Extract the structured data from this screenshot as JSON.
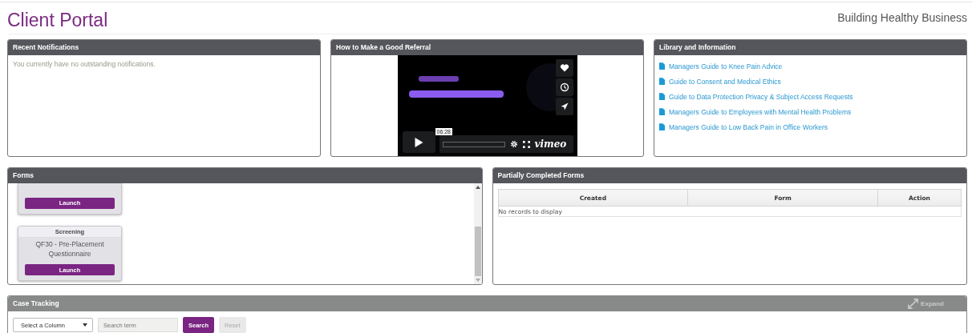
{
  "header": {
    "title": "Client Portal",
    "tagline": "Building Healthy Business"
  },
  "notifications": {
    "title": "Recent Notifications",
    "message": "You currently have no outstanding notifications."
  },
  "video": {
    "title": "How to Make a Good Referral",
    "player": {
      "time": "06:28",
      "brand": "vimeo"
    }
  },
  "library": {
    "title": "Library and Information",
    "links": [
      "Managers Guide to Knee Pain Advice",
      "Guide to Consent and Medical Ethics",
      "Guide to Data Protection Privacy & Subject Access Requests",
      "Managers Guide to Employees with Mental Health Problems",
      "Managers Guide to Low Back Pain in Office Workers"
    ]
  },
  "forms": {
    "title": "Forms",
    "cards": [
      {
        "launch": "Launch"
      },
      {
        "category": "Screening",
        "name": "QF30 - Pre-Placement Questionnaire",
        "launch": "Launch"
      }
    ]
  },
  "partial": {
    "title": "Partially Completed Forms",
    "columns": [
      "Created",
      "Form",
      "Action"
    ],
    "empty": "No records to display"
  },
  "case_tracking": {
    "title": "Case Tracking",
    "expand": "Expand",
    "column_select": {
      "value": "Select a Column"
    },
    "search": {
      "placeholder": "Search term"
    },
    "buttons": [
      {
        "label": "Search",
        "disabled": false
      },
      {
        "label": "Reset",
        "disabled": true
      }
    ]
  }
}
